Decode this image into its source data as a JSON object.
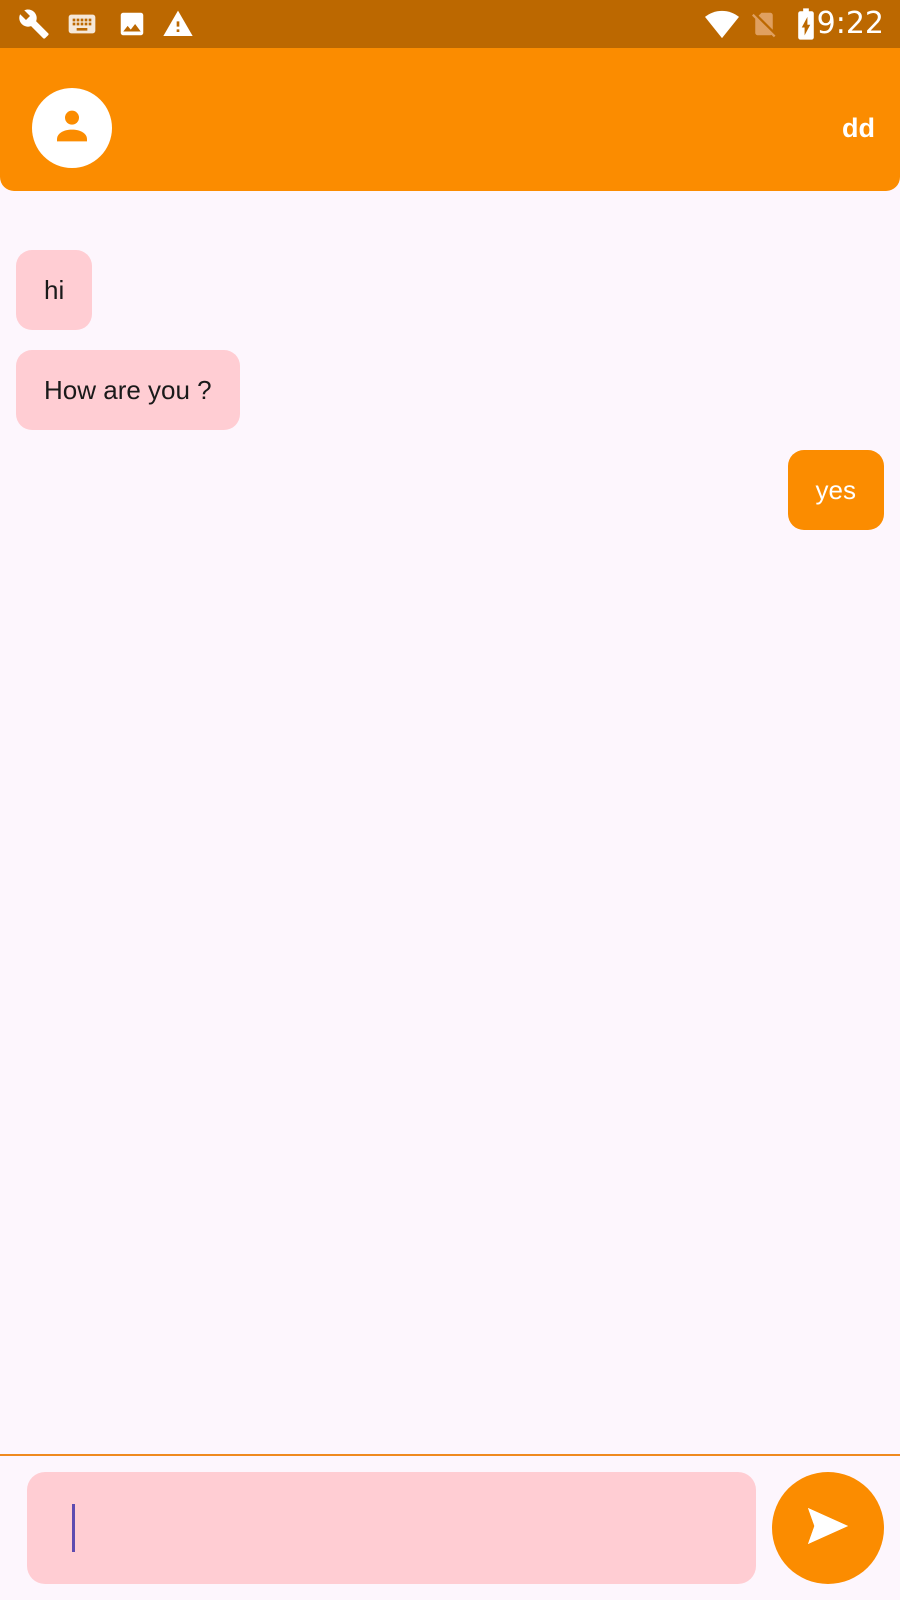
{
  "status_bar": {
    "time": "9:22",
    "left_icons": [
      "wrench-icon",
      "keyboard-icon",
      "image-icon",
      "warning-icon"
    ],
    "right_icons": [
      "wifi-icon",
      "no-sim-icon",
      "battery-charging-icon"
    ]
  },
  "app_bar": {
    "contact_name": "dd",
    "avatar_icon": "person-icon"
  },
  "messages": [
    {
      "text": "hi",
      "direction": "incoming"
    },
    {
      "text": "How are you ?",
      "direction": "incoming"
    },
    {
      "text": "yes",
      "direction": "outgoing"
    }
  ],
  "composer": {
    "value": "",
    "placeholder": "",
    "send_icon": "send-icon"
  },
  "colors": {
    "status_bar": "#bc6800",
    "accent": "#fb8c00",
    "incoming_bubble": "#ffcdd3",
    "background": "#fdf6fd",
    "caret": "#5e4bb0"
  }
}
